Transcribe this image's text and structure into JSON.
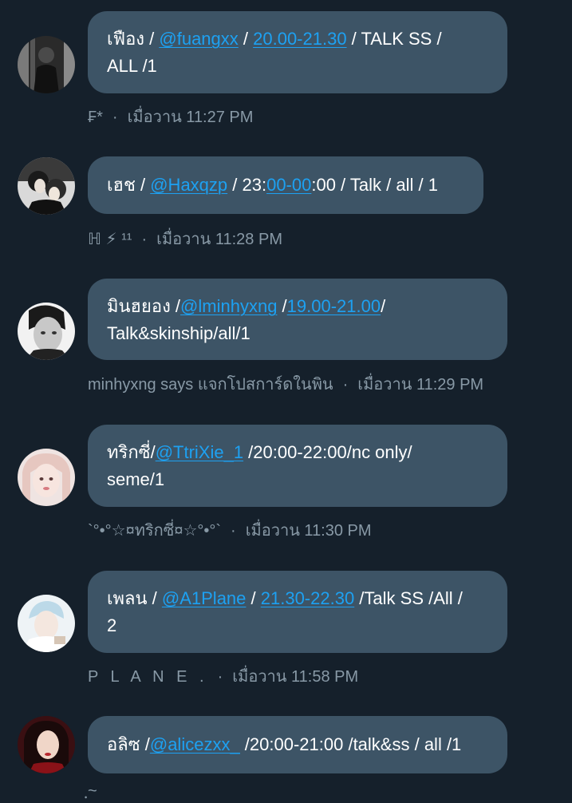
{
  "messages": [
    {
      "line1": {
        "t1": "เฟือง / ",
        "handle": "@fuangxx",
        "t2": " / ",
        "time": "20.00-21.30",
        "t3": " / TALK SS /"
      },
      "line2": "ALL /1",
      "sender": "₣*",
      "dot": "·",
      "timestamp": "เมื่อวาน 11:27 PM"
    },
    {
      "line1": {
        "t1": "เฮช / ",
        "handle": "@Haxqzp",
        "t2": " / 23:",
        "time": "00-00",
        "t3": ":00 / Talk / all / 1"
      },
      "sender": "ℍ ⚡ ¹¹",
      "dot": "·",
      "timestamp": "เมื่อวาน 11:28 PM"
    },
    {
      "line1": {
        "t1": "มินฮยอง /",
        "handle": "@lminhyxng",
        "t2": " /",
        "time": "19.00-21.00",
        "t3": "/"
      },
      "line2": "Talk&skinship/all/1",
      "sender": "minhyxng says แจกโปสการ์ดในพิน",
      "dot": "·",
      "timestamp": "เมื่อวาน 11:29 PM"
    },
    {
      "line1": {
        "t1": "ทริกซี่/",
        "handle": "@TtriXie_1",
        "t3": " /20:00-22:00/nc only/"
      },
      "line2": "seme/1",
      "sender": "`°•°☆¤ทริกซี่¤☆°•°`",
      "dot": "·",
      "timestamp": "เมื่อวาน 11:30 PM"
    },
    {
      "line1": {
        "t1": "เพลน / ",
        "handle": "@A1Plane",
        "t2": " / ",
        "time": "21.30-22.30",
        "t3": " /Talk SS /All /"
      },
      "line2": "2",
      "sender": "P L A N E .",
      "dot": "·",
      "timestamp": "เมื่อวาน 11:58 PM"
    },
    {
      "line1": {
        "t1": "อลิซ /",
        "handle": "@alicezxx_",
        "t3": " /20:00-21:00 /talk&ss / all /1"
      },
      "sender": "ฺ~",
      "dot": "",
      "timestamp": ""
    }
  ],
  "colors": {
    "background": "#15202b",
    "bubble": "#3d5466",
    "link": "#1da1f2",
    "meta": "#8899a6"
  }
}
